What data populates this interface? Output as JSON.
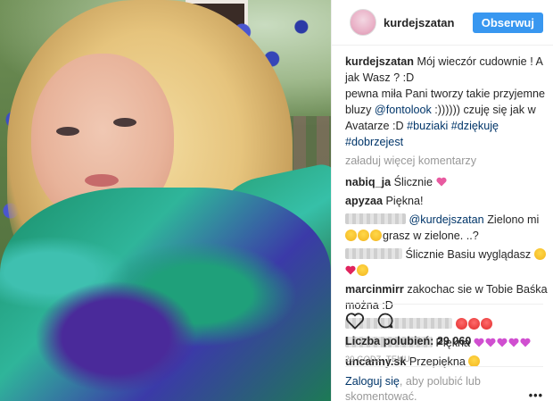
{
  "header": {
    "username": "kurdejszatan",
    "follow_label": "Obserwuj"
  },
  "caption": {
    "username": "kurdejszatan",
    "text1": "Mój wieczór cudownie ! A jak Wasz ? :D",
    "text2": "pewna miła Pani tworzy takie przyjemne bluzy ",
    "mention": "@fontolook",
    "text3": " :)))))) czuję się jak w Avatarze :D ",
    "tags": [
      "#buziaki",
      "#dziękuję",
      "#dobrzejest"
    ]
  },
  "load_more_label": "załaduj więcej komentarzy",
  "comments": [
    {
      "user": "nabiq_ja",
      "text": "Ślicznie"
    },
    {
      "user": "apyzaa",
      "text": "Piękna!"
    },
    {
      "user": "",
      "mention": "@kurdejszatan",
      "text": " Zielono mi ",
      "text_b": "grasz w zielone. ..?"
    },
    {
      "user": "",
      "text": "Ślicznie Basiu wyglądasz"
    },
    {
      "user": "marcinmirr",
      "text": "zakochac sie w Tobie Baśka można :D"
    },
    {
      "user": "",
      "text": ""
    },
    {
      "user": "",
      "text": "Piękna"
    },
    {
      "user": "uncanny.sk",
      "text": "Przepiękna"
    }
  ],
  "likes": {
    "label": "Liczba polubień: 29 060"
  },
  "timestamp": "20 GODZ. TEMU",
  "login": {
    "link": "Zaloguj się",
    "rest": ", aby polubić lub skomentować."
  },
  "icons": {
    "like": "heart-outline-icon",
    "comment": "comment-bubble-icon",
    "more": "more-options-icon"
  },
  "colors": {
    "follow_bg": "#3897f0",
    "link": "#003569",
    "muted": "#999999"
  }
}
